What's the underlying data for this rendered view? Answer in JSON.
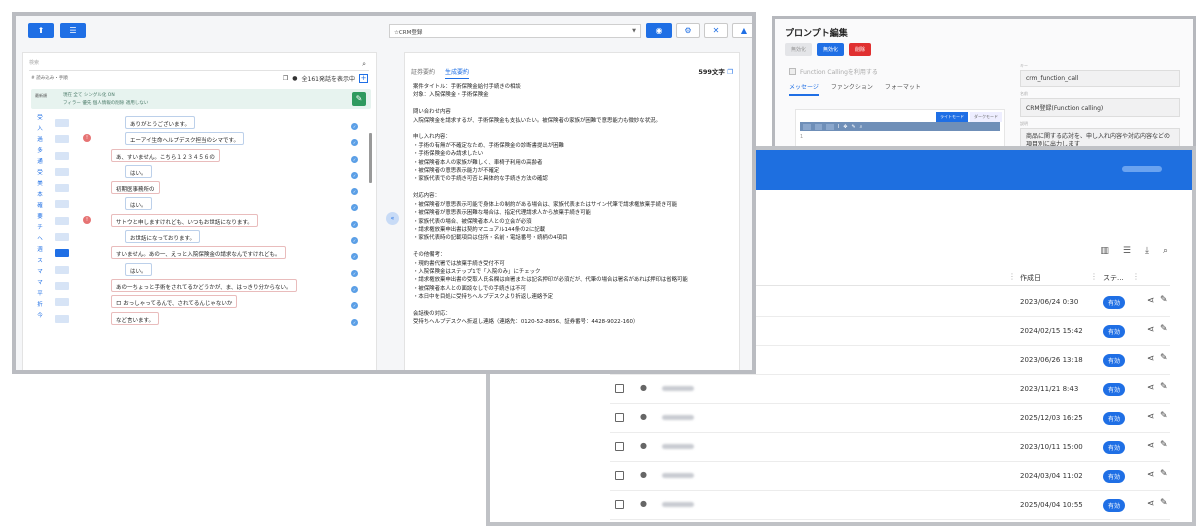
{
  "prompt_editor": {
    "title": "プロンプト編集",
    "buttons": {
      "disable": "無効化",
      "enable": "無効化",
      "delete": "削除"
    },
    "function_calling_label": "Function Callingを利用する",
    "tabs": [
      "メッセージ",
      "ファンクション",
      "フォーマット"
    ],
    "editor_modes": [
      "ライトモード",
      "ダークモード"
    ],
    "editor_line_number": "1",
    "fields": {
      "key_label": "キー",
      "key_value": "crm_function_call",
      "name_label": "名前",
      "name_value": "CRM登録(Function calling)",
      "desc_label": "説明",
      "desc_value": "商品に関する応対を、申し入れ内容や対応内容などの項目別に出力します"
    }
  },
  "list": {
    "columns": {
      "date": "作成日",
      "status": "ステ..."
    },
    "rows": [
      {
        "date": "2023/06/24 0:30",
        "status": "有効"
      },
      {
        "date": "2024/02/15 15:42",
        "status": "有効"
      },
      {
        "date": "2023/06/26 13:18",
        "status": "有効"
      },
      {
        "date": "2023/11/21 8:43",
        "status": "有効"
      },
      {
        "date": "2025/12/03 16:25",
        "status": "有効"
      },
      {
        "date": "2023/10/11 15:00",
        "status": "有効"
      },
      {
        "date": "2024/03/04 11:02",
        "status": "有効"
      },
      {
        "date": "2025/04/04 10:55",
        "status": "有効"
      }
    ]
  },
  "main": {
    "crm_select": "☆CRM登録",
    "search_placeholder": "検索",
    "filter_path": "# 読み込み・手順",
    "count_text": "全161発話を表示中",
    "filter_line1": "現在  全て  シングル化  ON",
    "filter_line2": "フィラー  優先  個人情報の削除  適用しない",
    "filter_mini": "最新順",
    "vertical_labels": [
      "受",
      "入",
      "過",
      "多",
      "通",
      "受",
      "美",
      "本",
      "確",
      "要",
      "チ",
      "ヘ",
      "週",
      "ス",
      "マ",
      "マ",
      "平",
      "折",
      "今"
    ],
    "utterances": [
      {
        "text": "ありがとうございます。",
        "speaker": "op"
      },
      {
        "text": "エーアイ生命ヘルプデスク担当のシマです。",
        "speaker": "op"
      },
      {
        "text": "あ、すいません。こちら１２３４５６の",
        "speaker": "cust"
      },
      {
        "text": "はい。",
        "speaker": "op"
      },
      {
        "text": "初期医事務所の",
        "speaker": "cust"
      },
      {
        "text": "はい。",
        "speaker": "op"
      },
      {
        "text": "サトウと申しますけれども、いつもお世話になります。",
        "speaker": "cust"
      },
      {
        "text": "お世話になっております。",
        "speaker": "op"
      },
      {
        "text": "すいません。あの一、えっと入院保険金の請求なんですけれども。",
        "speaker": "cust"
      },
      {
        "text": "はい。",
        "speaker": "op"
      },
      {
        "text": "あの一ちょっと手術をされてるかどうかが、ま、はっきり分からない。",
        "speaker": "cust"
      },
      {
        "text": "ロ おっしゃってるんで、されてるんじゃないか",
        "speaker": "cust"
      },
      {
        "text": "など言います。",
        "speaker": "cust"
      }
    ],
    "tabs": [
      "証券要約",
      "生成要約"
    ],
    "char_count": "599文字",
    "summary": "案件タイトル：手術保険金給付手続きの相談\n対象：入院保険金・手術保険金\n\n問い合わせ内容\n入院保険金を請求するが、手術保険金も支払いたい。被保険者の家族が困難で意思能力も微妙な状況。\n\n申し入れ内容：\n・手術の有無が不確定なため、手術保険金の診断書提出が困難\n・手術保険金のみ請求したい\n・被保険者本人の家族が難しく、車椅子利用の高齢者\n・被保険者の意思表示能力が不確定\n・家族代表での手続き可否と具体的な手続き方法の確認\n\n対応内容：\n・被保険者が意思表示可能で身体上の制約がある場合は、家族代表またはサイン代筆で請求権放棄手続き可能\n・被保険者が意思表示困難な場合は、指定代理請求人から放棄手続き可能\n・家族代表の場合、被保険者本人との立会が必須\n・請求権放棄申出書は契約マニュアル144条の2に記載\n・家族代表時の記載項目は住所・名前・電話番号・続柄の4項目\n\nその他備考：\n・現約書代署では放棄手続き受付不可\n・入院保険金はステップ1で「入院のみ」にチェック\n・請求権放棄申出書の受取人氏名欄は自署または記名押印が必須だが、代筆の場合は署名があれば押印は省略可能\n・被保険者本人との面談なしでの手続きは不可\n・本日中を目処に受持ちヘルプデスクより折返し連絡予定\n\n会話後の対応：\n受持ちヘルプデスクへ折返し連絡（連絡先：0120-52-8856、証券番号：4428-9022-160）"
  }
}
